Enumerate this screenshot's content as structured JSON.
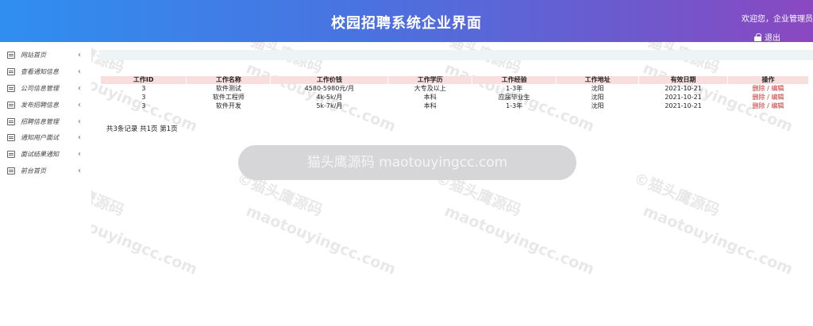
{
  "header": {
    "title": "校园招聘系统企业界面",
    "welcome": "欢迎您，企业管理员",
    "logout_label": "退出"
  },
  "sidebar": {
    "items": [
      {
        "label": "网站首页"
      },
      {
        "label": "查看通知信息"
      },
      {
        "label": "公司信息管理"
      },
      {
        "label": "发布招聘信息"
      },
      {
        "label": "招聘信息管理"
      },
      {
        "label": "通知用户面试"
      },
      {
        "label": "面试结果通知"
      },
      {
        "label": "前台首页"
      }
    ]
  },
  "table": {
    "headers": [
      "工作ID",
      "工作名称",
      "工作价钱",
      "工作学历",
      "工作经验",
      "工作地址",
      "有效日期",
      "操作"
    ],
    "rows": [
      {
        "id": "3",
        "name": "软件测试",
        "salary": "4580-5980元/月",
        "education": "大专及以上",
        "experience": "1-3年",
        "address": "沈阳",
        "date": "2021-10-21",
        "delete": "删除",
        "sep": " / ",
        "edit": "编辑"
      },
      {
        "id": "3",
        "name": "软件工程师",
        "salary": "4k-5k/月",
        "education": "本科",
        "experience": "应届毕业生",
        "address": "沈阳",
        "date": "2021-10-21",
        "delete": "删除",
        "sep": " / ",
        "edit": "编辑"
      },
      {
        "id": "3",
        "name": "软件开发",
        "salary": "5k-7k/月",
        "education": "本科",
        "experience": "1-3年",
        "address": "沈阳",
        "date": "2021-10-21",
        "delete": "删除",
        "sep": " / ",
        "edit": "编辑"
      }
    ]
  },
  "pager": {
    "text": "共3条记录 共1页 第1页"
  },
  "toast": {
    "text": "猫头鹰源码 maotouyingcc.com"
  },
  "watermark": {
    "lines": [
      "©猫头鹰源码",
      "maotouyingcc.com"
    ]
  }
}
